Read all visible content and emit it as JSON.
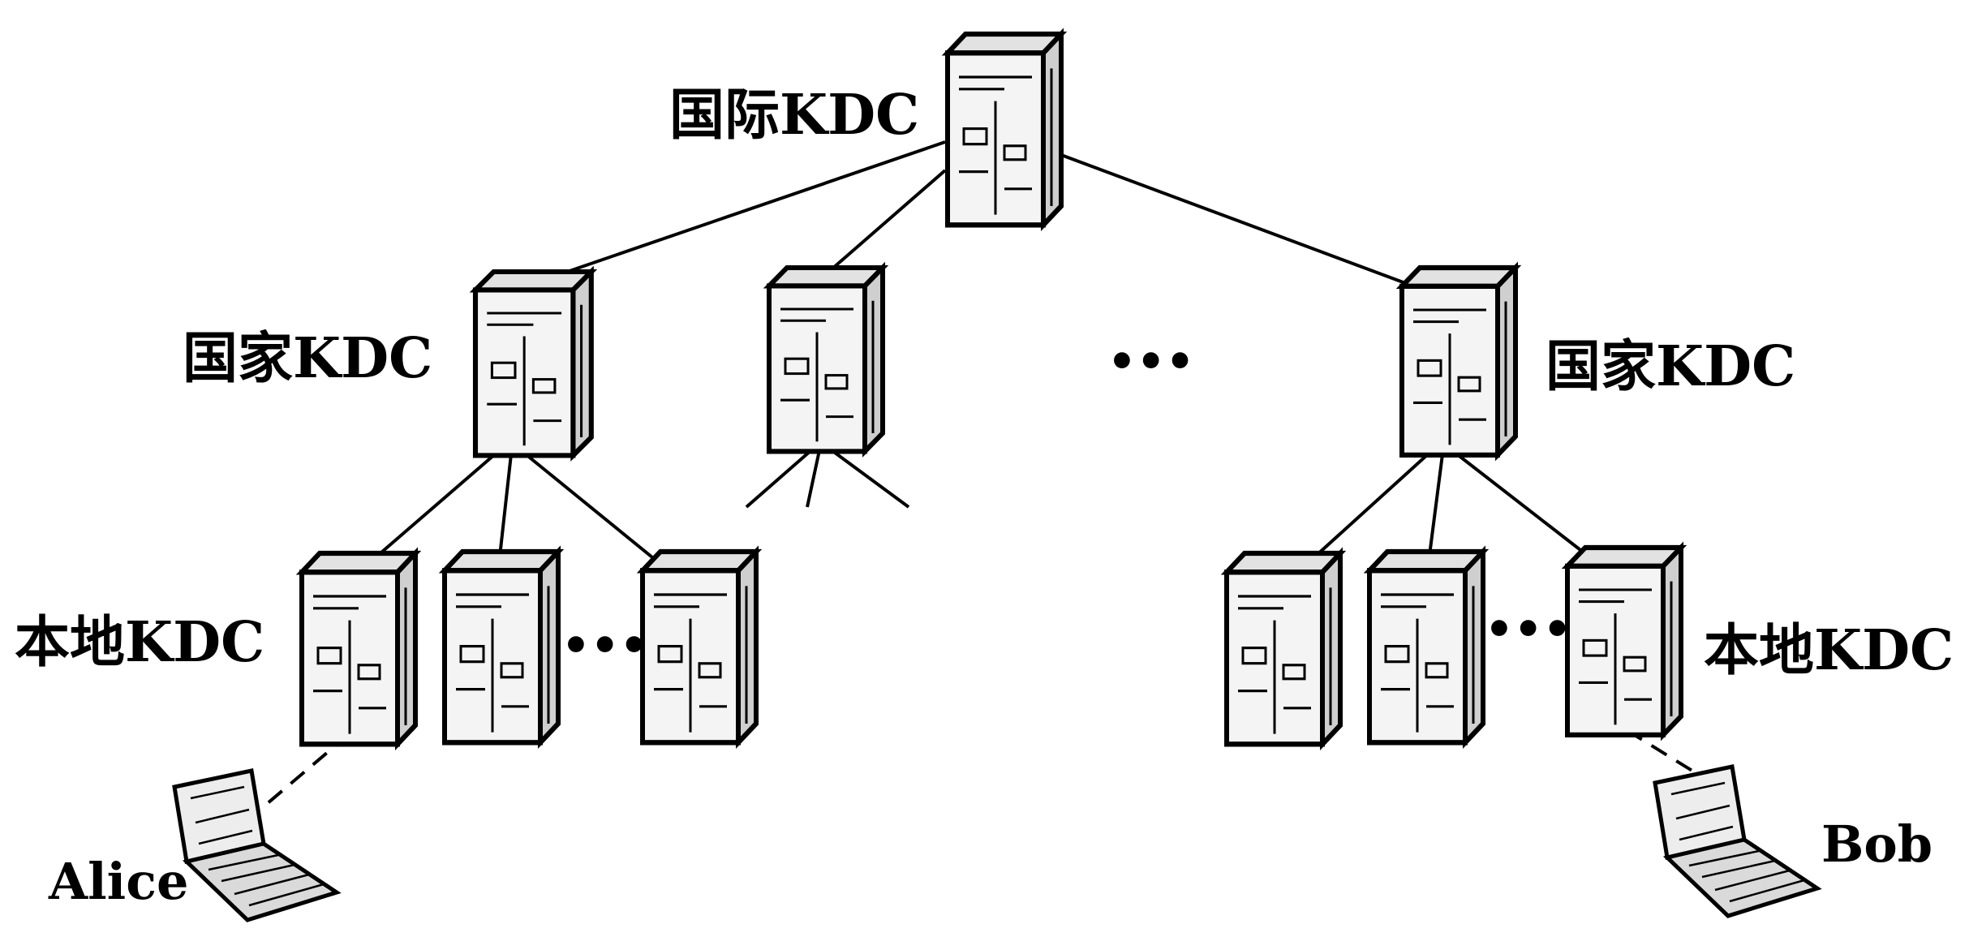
{
  "labels": {
    "international_kdc": "国际KDC",
    "national_kdc_left": "国家KDC",
    "national_kdc_right": "国家KDC",
    "local_kdc_left": "本地KDC",
    "local_kdc_right": "本地KDC",
    "alice": "Alice",
    "bob": "Bob"
  },
  "ellipses": {
    "national_level": "•••",
    "local_left": "•••",
    "local_right": "•••"
  }
}
